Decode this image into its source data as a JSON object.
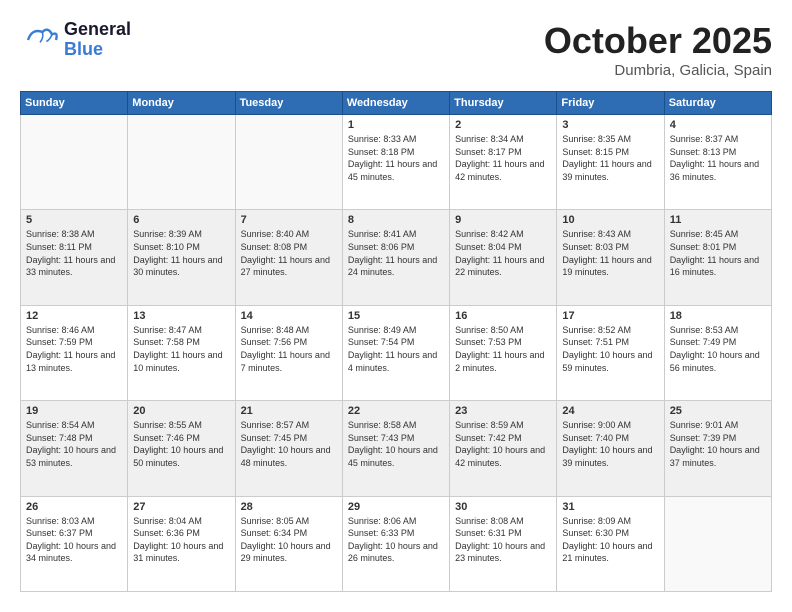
{
  "header": {
    "logo_general": "General",
    "logo_blue": "Blue",
    "month_title": "October 2025",
    "location": "Dumbria, Galicia, Spain"
  },
  "days_of_week": [
    "Sunday",
    "Monday",
    "Tuesday",
    "Wednesday",
    "Thursday",
    "Friday",
    "Saturday"
  ],
  "weeks": [
    {
      "cells": [
        {
          "day": "",
          "empty": true
        },
        {
          "day": "",
          "empty": true
        },
        {
          "day": "",
          "empty": true
        },
        {
          "day": "1",
          "sunrise": "Sunrise: 8:33 AM",
          "sunset": "Sunset: 8:18 PM",
          "daylight": "Daylight: 11 hours and 45 minutes."
        },
        {
          "day": "2",
          "sunrise": "Sunrise: 8:34 AM",
          "sunset": "Sunset: 8:17 PM",
          "daylight": "Daylight: 11 hours and 42 minutes."
        },
        {
          "day": "3",
          "sunrise": "Sunrise: 8:35 AM",
          "sunset": "Sunset: 8:15 PM",
          "daylight": "Daylight: 11 hours and 39 minutes."
        },
        {
          "day": "4",
          "sunrise": "Sunrise: 8:37 AM",
          "sunset": "Sunset: 8:13 PM",
          "daylight": "Daylight: 11 hours and 36 minutes."
        }
      ]
    },
    {
      "cells": [
        {
          "day": "5",
          "sunrise": "Sunrise: 8:38 AM",
          "sunset": "Sunset: 8:11 PM",
          "daylight": "Daylight: 11 hours and 33 minutes."
        },
        {
          "day": "6",
          "sunrise": "Sunrise: 8:39 AM",
          "sunset": "Sunset: 8:10 PM",
          "daylight": "Daylight: 11 hours and 30 minutes."
        },
        {
          "day": "7",
          "sunrise": "Sunrise: 8:40 AM",
          "sunset": "Sunset: 8:08 PM",
          "daylight": "Daylight: 11 hours and 27 minutes."
        },
        {
          "day": "8",
          "sunrise": "Sunrise: 8:41 AM",
          "sunset": "Sunset: 8:06 PM",
          "daylight": "Daylight: 11 hours and 24 minutes."
        },
        {
          "day": "9",
          "sunrise": "Sunrise: 8:42 AM",
          "sunset": "Sunset: 8:04 PM",
          "daylight": "Daylight: 11 hours and 22 minutes."
        },
        {
          "day": "10",
          "sunrise": "Sunrise: 8:43 AM",
          "sunset": "Sunset: 8:03 PM",
          "daylight": "Daylight: 11 hours and 19 minutes."
        },
        {
          "day": "11",
          "sunrise": "Sunrise: 8:45 AM",
          "sunset": "Sunset: 8:01 PM",
          "daylight": "Daylight: 11 hours and 16 minutes."
        }
      ]
    },
    {
      "cells": [
        {
          "day": "12",
          "sunrise": "Sunrise: 8:46 AM",
          "sunset": "Sunset: 7:59 PM",
          "daylight": "Daylight: 11 hours and 13 minutes."
        },
        {
          "day": "13",
          "sunrise": "Sunrise: 8:47 AM",
          "sunset": "Sunset: 7:58 PM",
          "daylight": "Daylight: 11 hours and 10 minutes."
        },
        {
          "day": "14",
          "sunrise": "Sunrise: 8:48 AM",
          "sunset": "Sunset: 7:56 PM",
          "daylight": "Daylight: 11 hours and 7 minutes."
        },
        {
          "day": "15",
          "sunrise": "Sunrise: 8:49 AM",
          "sunset": "Sunset: 7:54 PM",
          "daylight": "Daylight: 11 hours and 4 minutes."
        },
        {
          "day": "16",
          "sunrise": "Sunrise: 8:50 AM",
          "sunset": "Sunset: 7:53 PM",
          "daylight": "Daylight: 11 hours and 2 minutes."
        },
        {
          "day": "17",
          "sunrise": "Sunrise: 8:52 AM",
          "sunset": "Sunset: 7:51 PM",
          "daylight": "Daylight: 10 hours and 59 minutes."
        },
        {
          "day": "18",
          "sunrise": "Sunrise: 8:53 AM",
          "sunset": "Sunset: 7:49 PM",
          "daylight": "Daylight: 10 hours and 56 minutes."
        }
      ]
    },
    {
      "cells": [
        {
          "day": "19",
          "sunrise": "Sunrise: 8:54 AM",
          "sunset": "Sunset: 7:48 PM",
          "daylight": "Daylight: 10 hours and 53 minutes."
        },
        {
          "day": "20",
          "sunrise": "Sunrise: 8:55 AM",
          "sunset": "Sunset: 7:46 PM",
          "daylight": "Daylight: 10 hours and 50 minutes."
        },
        {
          "day": "21",
          "sunrise": "Sunrise: 8:57 AM",
          "sunset": "Sunset: 7:45 PM",
          "daylight": "Daylight: 10 hours and 48 minutes."
        },
        {
          "day": "22",
          "sunrise": "Sunrise: 8:58 AM",
          "sunset": "Sunset: 7:43 PM",
          "daylight": "Daylight: 10 hours and 45 minutes."
        },
        {
          "day": "23",
          "sunrise": "Sunrise: 8:59 AM",
          "sunset": "Sunset: 7:42 PM",
          "daylight": "Daylight: 10 hours and 42 minutes."
        },
        {
          "day": "24",
          "sunrise": "Sunrise: 9:00 AM",
          "sunset": "Sunset: 7:40 PM",
          "daylight": "Daylight: 10 hours and 39 minutes."
        },
        {
          "day": "25",
          "sunrise": "Sunrise: 9:01 AM",
          "sunset": "Sunset: 7:39 PM",
          "daylight": "Daylight: 10 hours and 37 minutes."
        }
      ]
    },
    {
      "cells": [
        {
          "day": "26",
          "sunrise": "Sunrise: 8:03 AM",
          "sunset": "Sunset: 6:37 PM",
          "daylight": "Daylight: 10 hours and 34 minutes."
        },
        {
          "day": "27",
          "sunrise": "Sunrise: 8:04 AM",
          "sunset": "Sunset: 6:36 PM",
          "daylight": "Daylight: 10 hours and 31 minutes."
        },
        {
          "day": "28",
          "sunrise": "Sunrise: 8:05 AM",
          "sunset": "Sunset: 6:34 PM",
          "daylight": "Daylight: 10 hours and 29 minutes."
        },
        {
          "day": "29",
          "sunrise": "Sunrise: 8:06 AM",
          "sunset": "Sunset: 6:33 PM",
          "daylight": "Daylight: 10 hours and 26 minutes."
        },
        {
          "day": "30",
          "sunrise": "Sunrise: 8:08 AM",
          "sunset": "Sunset: 6:31 PM",
          "daylight": "Daylight: 10 hours and 23 minutes."
        },
        {
          "day": "31",
          "sunrise": "Sunrise: 8:09 AM",
          "sunset": "Sunset: 6:30 PM",
          "daylight": "Daylight: 10 hours and 21 minutes."
        },
        {
          "day": "",
          "empty": true
        }
      ]
    }
  ]
}
